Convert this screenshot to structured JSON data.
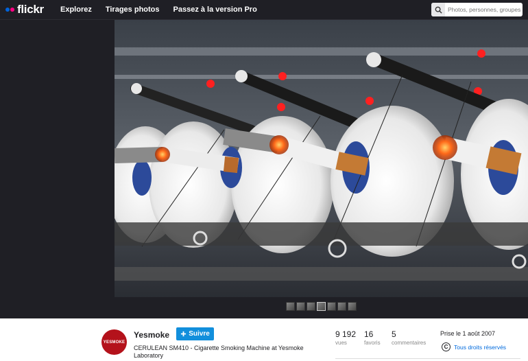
{
  "header": {
    "logo": "flickr",
    "nav": [
      "Explorez",
      "Tirages photos",
      "Passez à la version Pro"
    ],
    "search_placeholder": "Photos, personnes, groupes"
  },
  "owner": {
    "name": "Yesmoke",
    "avatar_text": "YESMOKE",
    "follow_label": "Suivre",
    "follow_icon": "plus-icon"
  },
  "photo": {
    "title": "CERULEAN SM410 - Cigarette Smoking Machine at Yesmoke Laboratory"
  },
  "stats": [
    {
      "value": "9 192",
      "label": "vues"
    },
    {
      "value": "16",
      "label": "favoris"
    },
    {
      "value": "5",
      "label": "commentaires"
    }
  ],
  "taken": "Prise le 1 août 2007",
  "license": {
    "icon": "copyright-icon",
    "text": "Tous droits réservés"
  },
  "colors": {
    "accent": "#128fdc",
    "brand_blue": "#0063dc",
    "brand_pink": "#ff0084",
    "avatar": "#b4121b"
  }
}
